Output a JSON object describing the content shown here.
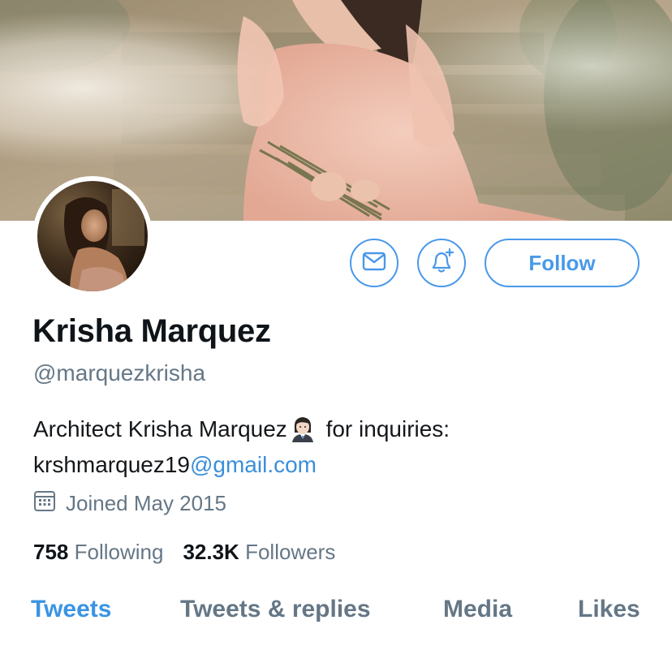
{
  "profile": {
    "display_name": "Krisha Marquez",
    "handle": "@marquezkrisha",
    "bio_text": "Architect Krisha Marquez",
    "bio_after_emoji": " for inquiries:",
    "bio_email_user": "krshmarquez19",
    "bio_email_domain": "@gmail.com",
    "bio_emoji": "woman-office-worker-emoji",
    "joined": "Joined May 2015",
    "following_count": "758",
    "following_label": "Following",
    "followers_count": "32.3K",
    "followers_label": "Followers"
  },
  "actions": {
    "message_icon": "envelope-icon",
    "notify_icon": "bell-plus-icon",
    "follow_label": "Follow"
  },
  "tabs": [
    {
      "label": "Tweets",
      "active": true
    },
    {
      "label": "Tweets & replies",
      "active": false
    },
    {
      "label": "Media",
      "active": false
    },
    {
      "label": "Likes",
      "active": false
    }
  ],
  "colors": {
    "accent": "#4a99e9",
    "text_primary": "#0f1419",
    "text_secondary": "#657786",
    "link": "#3b8fd9"
  }
}
